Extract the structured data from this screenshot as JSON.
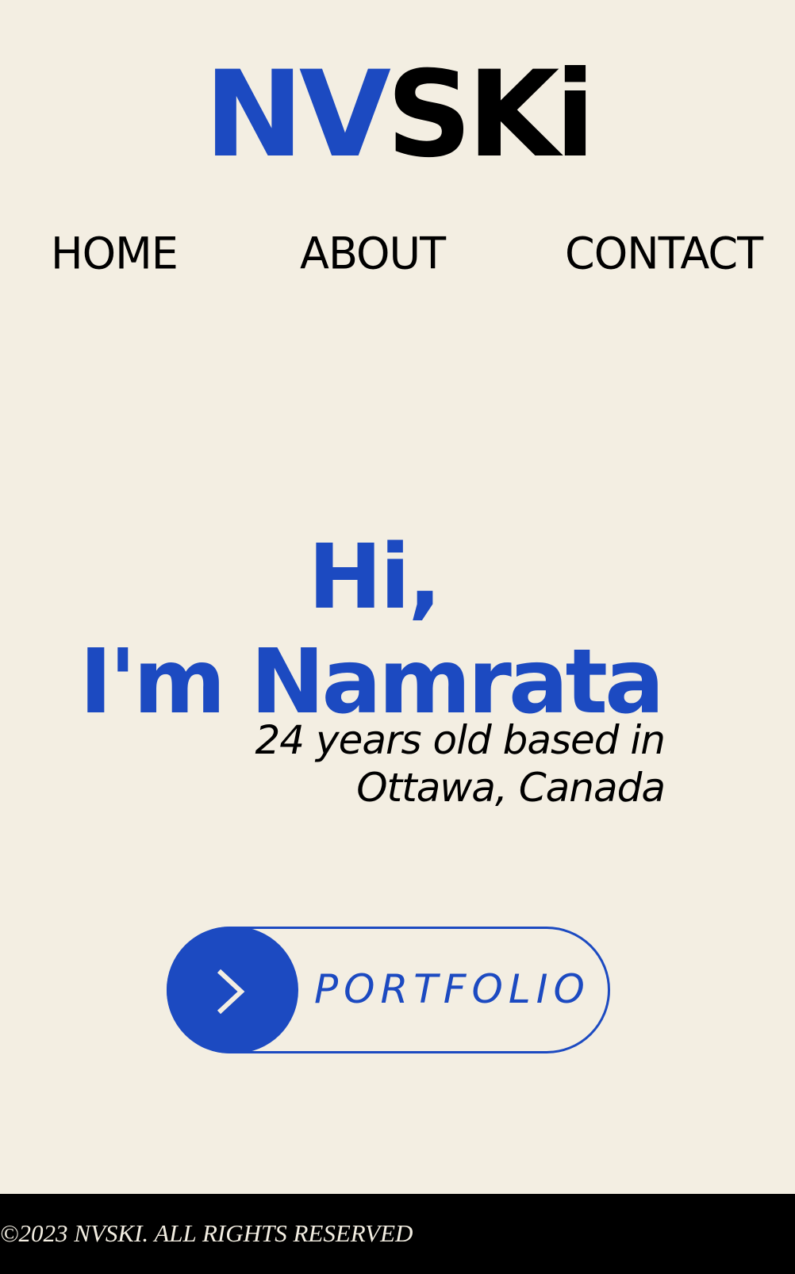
{
  "logo": {
    "part_blue": "NV",
    "part_black": "SKi"
  },
  "nav": {
    "home": "HOME",
    "about": "ABOUT",
    "contact": "CONTACT"
  },
  "hero": {
    "greeting": "Hi,",
    "name_line": "I'm Namrata",
    "subtitle_line1": "24 years old based in",
    "subtitle_line2": "Ottawa, Canada"
  },
  "portfolio_button": {
    "label": "PORTFOLIO",
    "icon": "chevron-right-icon"
  },
  "footer": {
    "copyright": "©2023 NVSKI. ALL RIGHTS RESERVED"
  },
  "colors": {
    "background": "#F3EEE2",
    "accent": "#1C4AC1",
    "text": "#000000",
    "footer_bg": "#000000"
  }
}
